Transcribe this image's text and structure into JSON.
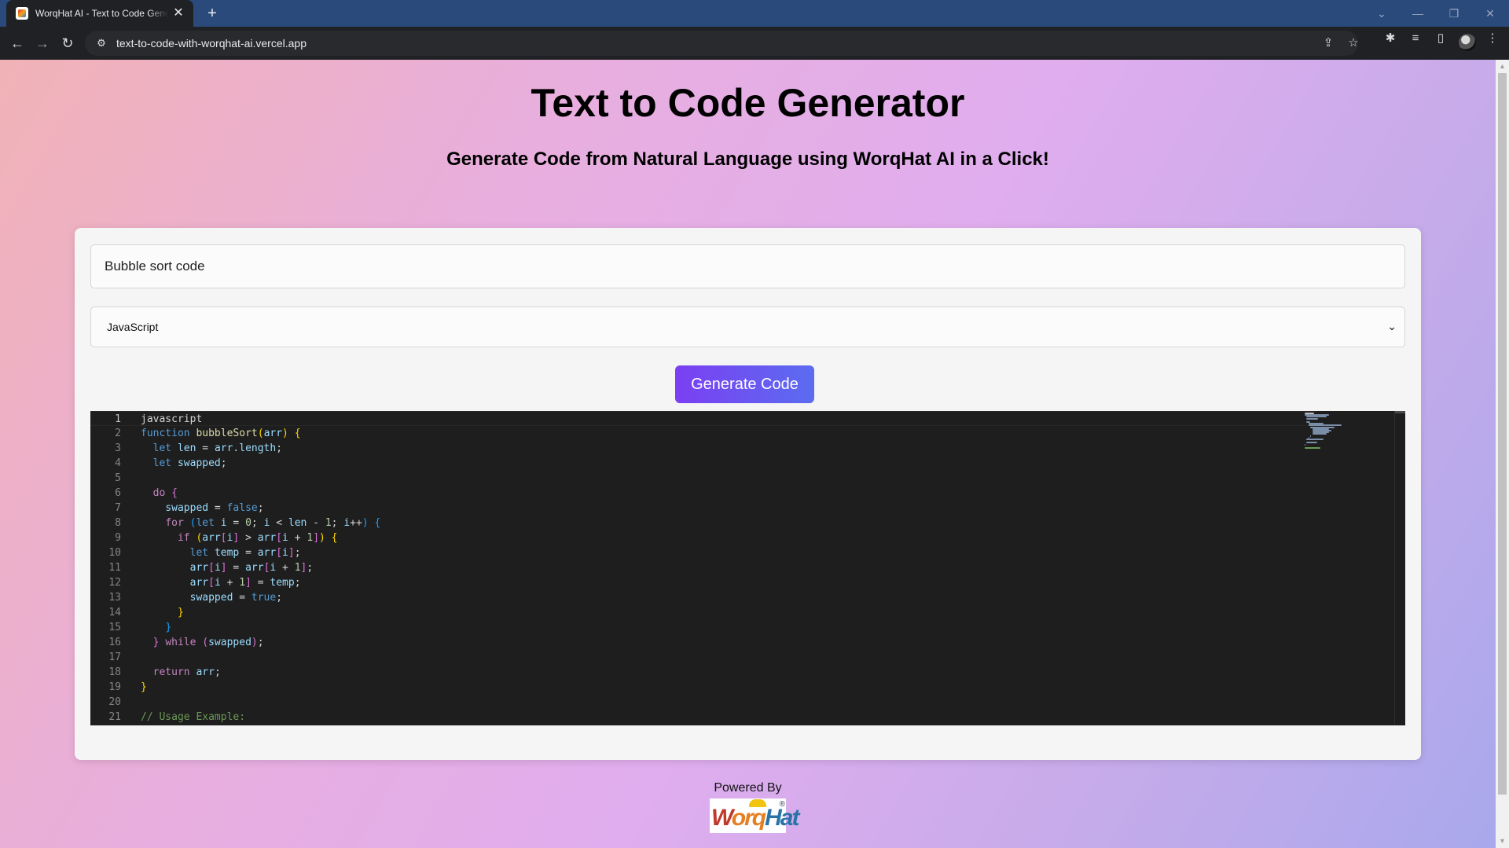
{
  "browser": {
    "tab_title": "WorqHat AI - Text to Code Generator",
    "url": "text-to-code-with-worqhat-ai.vercel.app",
    "new_tab_glyph": "+",
    "close_glyph": "✕",
    "back_glyph": "←",
    "forward_glyph": "→",
    "reload_glyph": "↻",
    "site_info_glyph": "⚙",
    "share_glyph": "⇪",
    "star_glyph": "☆",
    "extensions_glyph": "✱",
    "media_glyph": "≡",
    "sidepanel_glyph": "▯",
    "menu_glyph": "⋮",
    "window_controls": {
      "tabsearch": "⌄",
      "minimize": "—",
      "restore": "❐",
      "close": "✕"
    }
  },
  "header": {
    "title": "Text to Code Generator",
    "subtitle": "Generate Code from Natural Language using WorqHat AI in a Click!"
  },
  "form": {
    "prompt_value": "Bubble sort code",
    "language_selected": "JavaScript",
    "select_chevron": "⌄",
    "generate_label": "Generate Code"
  },
  "editor": {
    "lines": [
      {
        "n": "1",
        "code": "javascript"
      },
      {
        "n": "2",
        "code": "function bubbleSort(arr) {"
      },
      {
        "n": "3",
        "code": "  let len = arr.length;"
      },
      {
        "n": "4",
        "code": "  let swapped;"
      },
      {
        "n": "5",
        "code": ""
      },
      {
        "n": "6",
        "code": "  do {"
      },
      {
        "n": "7",
        "code": "    swapped = false;"
      },
      {
        "n": "8",
        "code": "    for (let i = 0; i < len - 1; i++) {"
      },
      {
        "n": "9",
        "code": "      if (arr[i] > arr[i + 1]) {"
      },
      {
        "n": "10",
        "code": "        let temp = arr[i];"
      },
      {
        "n": "11",
        "code": "        arr[i] = arr[i + 1];"
      },
      {
        "n": "12",
        "code": "        arr[i + 1] = temp;"
      },
      {
        "n": "13",
        "code": "        swapped = true;"
      },
      {
        "n": "14",
        "code": "      }"
      },
      {
        "n": "15",
        "code": "    }"
      },
      {
        "n": "16",
        "code": "  } while (swapped);"
      },
      {
        "n": "17",
        "code": ""
      },
      {
        "n": "18",
        "code": "  return arr;"
      },
      {
        "n": "19",
        "code": "}"
      },
      {
        "n": "20",
        "code": ""
      },
      {
        "n": "21",
        "code": "// Usage Example:"
      }
    ]
  },
  "footer": {
    "powered_by": "Powered By",
    "logo_text": "WorqHat",
    "logo_reg": "®"
  },
  "colors": {
    "accent_start": "#7b3ff2",
    "accent_end": "#5b6cf0",
    "editor_bg": "#1e1e1e",
    "tabstrip": "#2b4a7c"
  }
}
